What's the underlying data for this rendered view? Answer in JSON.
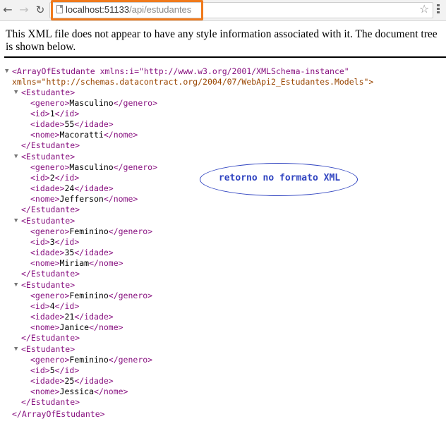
{
  "browser": {
    "url_host": "localhost:51133",
    "url_path": "/api/estudantes"
  },
  "info_text": "This XML file does not appear to have any style information associated with it. The document tree is shown below.",
  "root": {
    "open_line1": "<ArrayOfEstudante xmlns:i=\"http://www.w3.org/2001/XMLSchema-instance\"",
    "open_line2": "xmlns=\"http://schemas.datacontract.org/2004/07/WebApi2_Estudantes.Models\">",
    "close": "</ArrayOfEstudante>"
  },
  "estudantes": [
    {
      "genero": "Masculino",
      "id": "1",
      "idade": "55",
      "nome": "Macoratti"
    },
    {
      "genero": "Masculino",
      "id": "2",
      "idade": "24",
      "nome": "Jefferson"
    },
    {
      "genero": "Feminino",
      "id": "3",
      "idade": "35",
      "nome": "Miriam"
    },
    {
      "genero": "Feminino",
      "id": "4",
      "idade": "21",
      "nome": "Janice"
    },
    {
      "genero": "Feminino",
      "id": "5",
      "idade": "25",
      "nome": "Jessica"
    }
  ],
  "annotation": "retorno no formato XML"
}
